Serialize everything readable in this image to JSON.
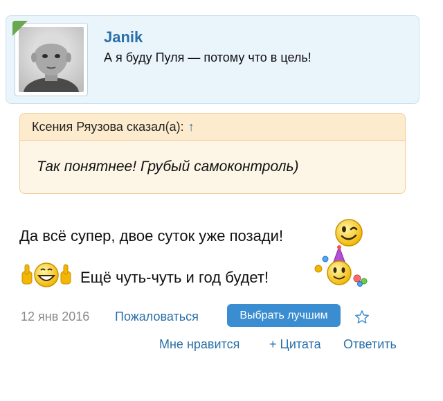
{
  "post": {
    "author": "Janik",
    "status": "А я буду Пуля — потому что в цель!"
  },
  "quote": {
    "header": "Ксения Ряузова сказал(а):",
    "arrow": "↑",
    "text": "Так понятнее! Грубый самоконтроль)"
  },
  "message": {
    "line1": "Да всё супер, двое суток уже позади!",
    "line2": "Ещё чуть-чуть и год будет!"
  },
  "meta": {
    "date": "12 янв 2016",
    "report": "Пожаловаться",
    "best": "Выбрать лучшим"
  },
  "actions": {
    "like": "Мне нравится",
    "quote": "+ Цитата",
    "reply": "Ответить"
  },
  "colors": {
    "link": "#2a6fa8",
    "button": "#3a8dd0",
    "profile_bg": "#eaf4fb",
    "quote_bg": "#fdf6e7"
  },
  "icons": [
    "wink-smiley-icon",
    "thumbs-up-smiley-icon",
    "party-smiley-icon",
    "star-icon"
  ]
}
